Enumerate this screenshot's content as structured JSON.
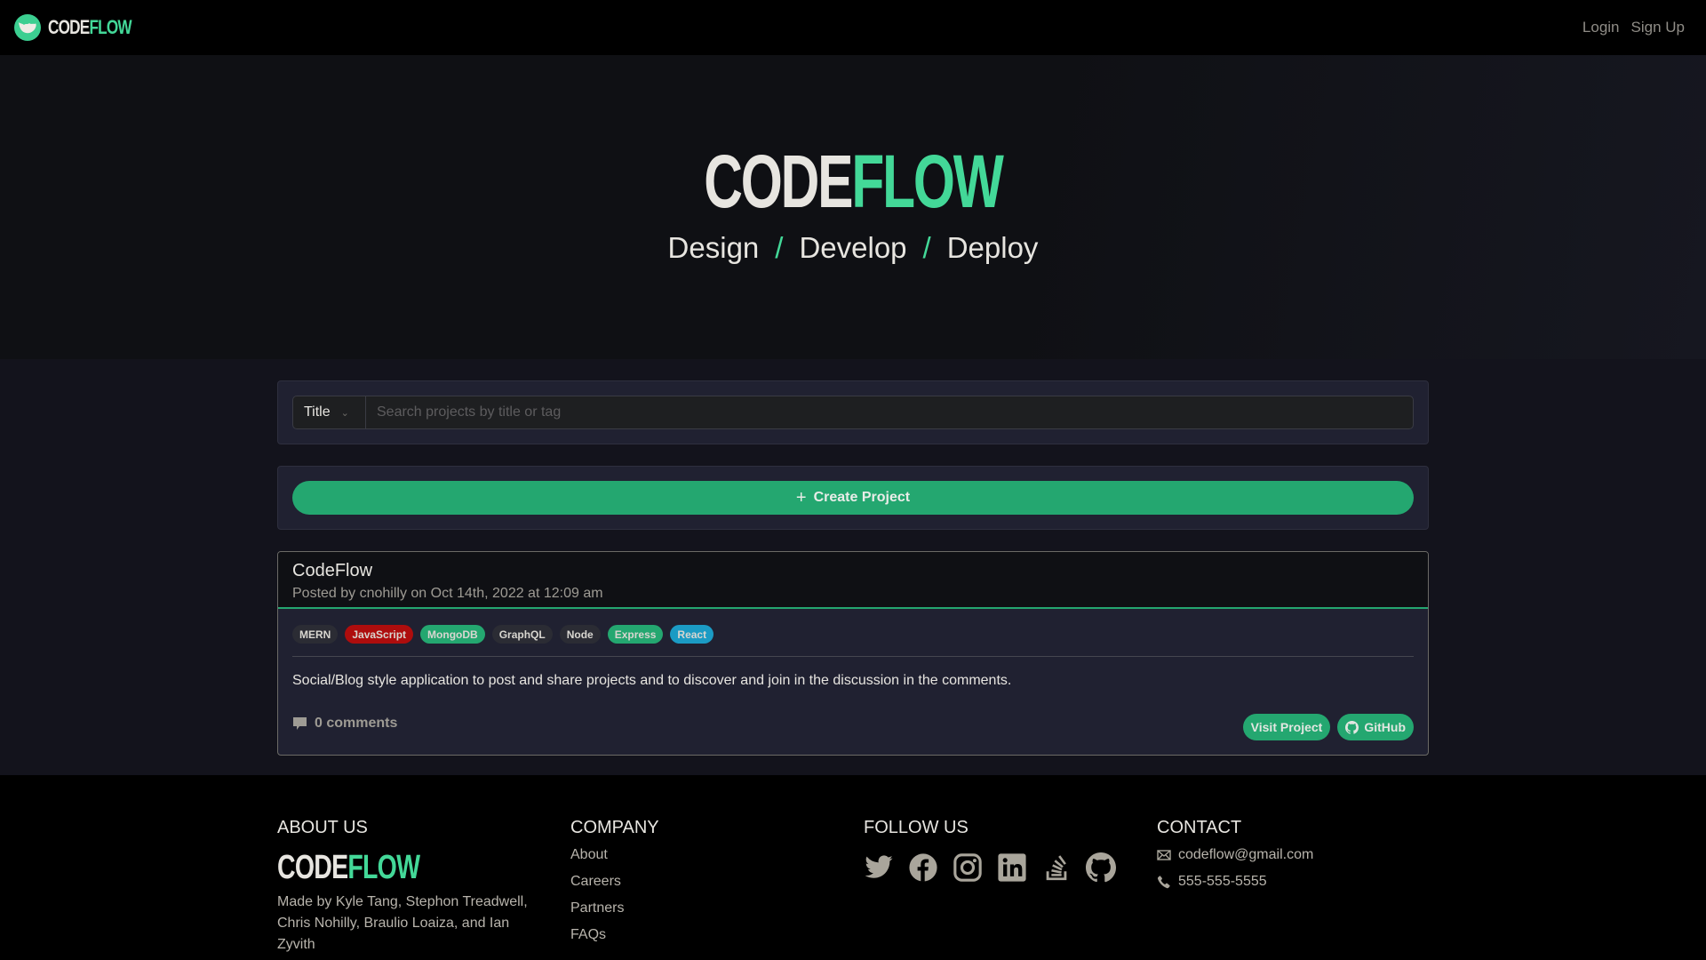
{
  "brand": {
    "word1": "CODE",
    "word2": "FLOW"
  },
  "nav": {
    "login": "Login",
    "signup": "Sign Up"
  },
  "hero": {
    "tagline": [
      "Design",
      "Develop",
      "Deploy"
    ],
    "separator": "/"
  },
  "search": {
    "filter_selected": "Title",
    "placeholder": "Search projects by title or tag",
    "value": ""
  },
  "create": {
    "label": "Create Project",
    "icon": "plus-icon"
  },
  "project": {
    "title": "CodeFlow",
    "meta": "Posted by cnohilly on Oct 14th, 2022 at 12:09 am",
    "tags": [
      {
        "label": "MERN",
        "color": "#2b2c34"
      },
      {
        "label": "JavaScript",
        "color": "#ae0d0d"
      },
      {
        "label": "MongoDB",
        "color": "#24a770"
      },
      {
        "label": "GraphQL",
        "color": "#2b2c34"
      },
      {
        "label": "Node",
        "color": "#2b2c34"
      },
      {
        "label": "Express",
        "color": "#24a770"
      },
      {
        "label": "React",
        "color": "#1b9bc4"
      }
    ],
    "description": "Social/Blog style application to post and share projects and to discover and join in the discussion in the comments.",
    "comments": "0 comments",
    "visit_label": "Visit Project",
    "github_label": "GitHub"
  },
  "footer": {
    "about": {
      "heading": "ABOUT US",
      "text": "Made by Kyle Tang, Stephon Treadwell, Chris Nohilly, Braulio Loaiza, and Ian Zyvith"
    },
    "company": {
      "heading": "COMPANY",
      "links": [
        "About",
        "Careers",
        "Partners",
        "FAQs"
      ]
    },
    "follow": {
      "heading": "FOLLOW US",
      "icons": [
        "twitter-icon",
        "facebook-icon",
        "instagram-icon",
        "linkedin-icon",
        "stackoverflow-icon",
        "github-icon"
      ]
    },
    "contact": {
      "heading": "CONTACT",
      "email": "codeflow@gmail.com",
      "phone": "555-555-5555"
    }
  },
  "colors": {
    "accent": "#43d898",
    "button": "#24a770",
    "panel": "#202131"
  }
}
